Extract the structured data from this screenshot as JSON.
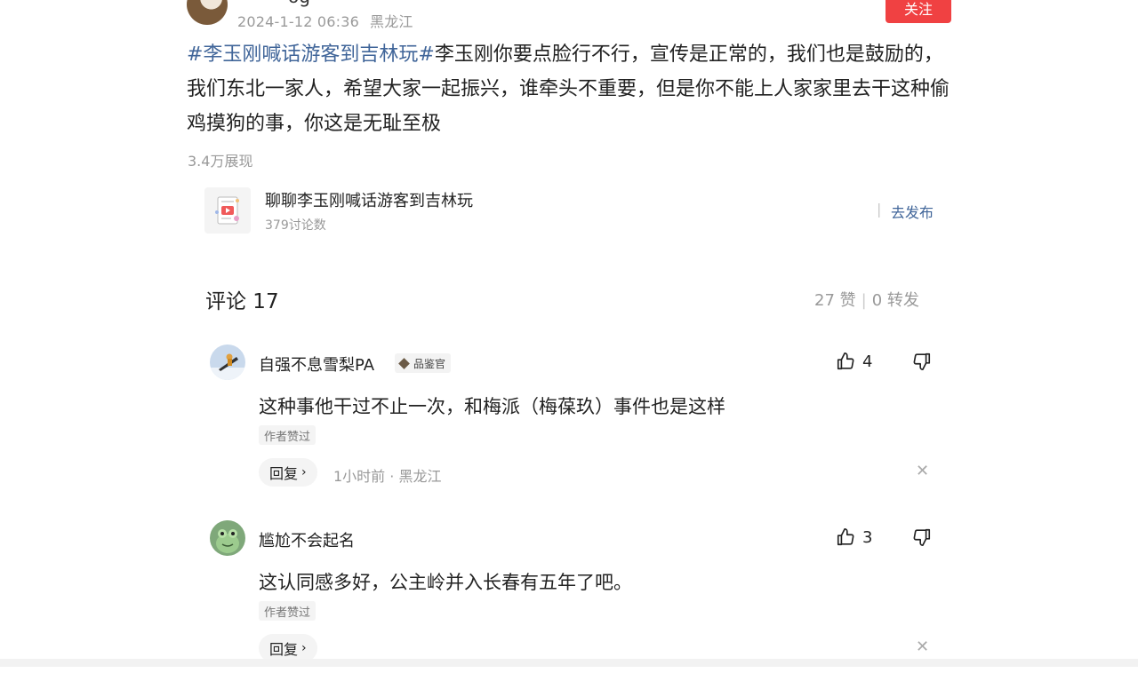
{
  "post": {
    "author_name": "og",
    "timestamp": "2024-1-12 06:36",
    "location": "黑龙江",
    "follow_label": "关注",
    "hashtag": "#李玉刚喊话游客到吉林玩#",
    "body": "李玉刚你要点脸行不行，宣传是正常的，我们也是鼓励的，我们东北一家人，希望大家一起振兴，谁牵头不重要，但是你不能上人家家里去干这种偷鸡摸狗的事，你这是无耻至极",
    "views": "3.4万展现"
  },
  "topic": {
    "title": "聊聊李玉刚喊话游客到吉林玩",
    "discussion_count": "379讨论数",
    "separator": "|",
    "action_label": "去发布",
    "thumb_icon": "video-topic-icon"
  },
  "comments_header": {
    "title": "评论 17",
    "likes": "27 赞",
    "separator": "|",
    "shares": "0 转发"
  },
  "comments": [
    {
      "name": "自强不息雪梨PA",
      "badge": "品鉴官",
      "likes": "4",
      "text": "这种事他干过不止一次，和梅派（梅葆玖）事件也是这样",
      "author_liked": "作者赞过",
      "reply_label": "回复",
      "time_location": "1小时前 · 黑龙江"
    },
    {
      "name": "尴尬不会起名",
      "likes": "3",
      "text": "这认同感多好，公主岭并入长春有五年了吧。",
      "author_liked": "作者赞过",
      "reply_label": "回复"
    }
  ],
  "colors": {
    "accent_red": "#f04142",
    "link_blue": "#406599",
    "muted": "#999999"
  }
}
